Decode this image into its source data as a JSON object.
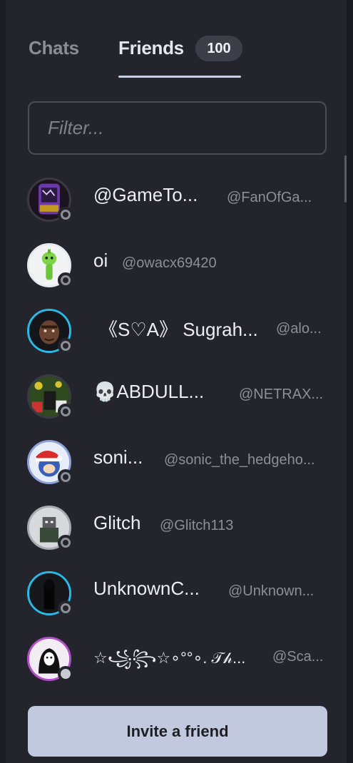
{
  "tabs": {
    "chats_label": "Chats",
    "friends_label": "Friends",
    "friends_count": "100"
  },
  "filter": {
    "placeholder": "Filter..."
  },
  "friends": [
    {
      "display_name": "@GameTo...",
      "username": "@FanOfGa...",
      "status": "offline"
    },
    {
      "display_name": "oi",
      "username": "@owacx69420",
      "status": "offline"
    },
    {
      "display_name": "《S♡A》 Sugrah...",
      "username": "@alo...",
      "status": "offline"
    },
    {
      "display_name": "💀ABDULL...",
      "username": "@NETRAX...",
      "status": "offline"
    },
    {
      "display_name": "soni...",
      "username": "@sonic_the_hedgeho...",
      "status": "offline"
    },
    {
      "display_name": "Glitch",
      "username": "@Glitch113",
      "status": "offline"
    },
    {
      "display_name": "UnknownC...",
      "username": "@Unknown...",
      "status": "offline"
    },
    {
      "display_name": "☆꧁꧂☆∘°°∘. 𝒯𝒽...",
      "username": "@Sca...",
      "status": "away"
    }
  ],
  "invite_button": {
    "label": "Invite a friend"
  },
  "colors": {
    "panel_bg": "#24252c",
    "accent": "#c2c9de",
    "muted_text": "#8c8e98"
  }
}
